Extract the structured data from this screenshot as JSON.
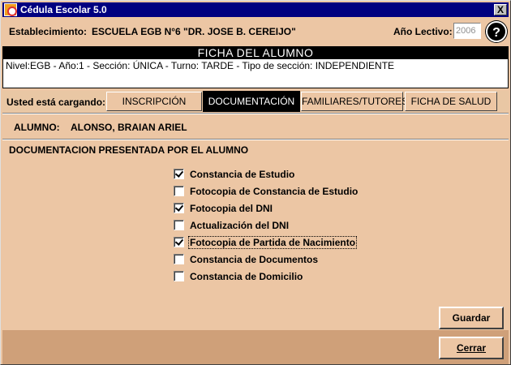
{
  "window": {
    "title": "Cédula Escolar 5.0",
    "close_glyph": "X"
  },
  "header": {
    "estab_label": "Establecimiento:",
    "estab_value": "ESCUELA EGB N°6 \"DR. JOSE B. CEREIJO\"",
    "year_label": "Año Lectivo:",
    "year_value": "2006",
    "help_glyph": "?"
  },
  "ficha": {
    "title": "FICHA DEL ALUMNO",
    "info": "Nivel:EGB - Año:1 - Sección: ÚNICA - Turno: TARDE - Tipo de sección: INDEPENDIENTE"
  },
  "tabs": {
    "loading_label": "Usted está cargando:",
    "items": [
      {
        "label": "INSCRIPCIÓN",
        "active": false
      },
      {
        "label": "DOCUMENTACIÓN",
        "active": true
      },
      {
        "label": "FAMILIARES/TUTORES",
        "active": false
      },
      {
        "label": "FICHA DE SALUD",
        "active": false
      }
    ]
  },
  "student": {
    "label": "ALUMNO:",
    "name": "ALONSO, BRAIAN ARIEL"
  },
  "documents": {
    "title": "DOCUMENTACION PRESENTADA POR EL ALUMNO",
    "items": [
      {
        "label": "Constancia de Estudio",
        "checked": true
      },
      {
        "label": "Fotocopia de Constancia de Estudio",
        "checked": false
      },
      {
        "label": "Fotocopia del DNI",
        "checked": true
      },
      {
        "label": "Actualización del DNI",
        "checked": false
      },
      {
        "label": "Fotocopia de Partida de Nacimiento",
        "checked": true,
        "focused": true
      },
      {
        "label": "Constancia de Documentos",
        "checked": false
      },
      {
        "label": "Constancia de Domicilio",
        "checked": false
      }
    ]
  },
  "buttons": {
    "save_label": "Guardar",
    "close_label": "Cerrar"
  },
  "colors": {
    "background": "#ecc6a4",
    "titlebar": "#000080",
    "footer_band": "#cfa079"
  }
}
